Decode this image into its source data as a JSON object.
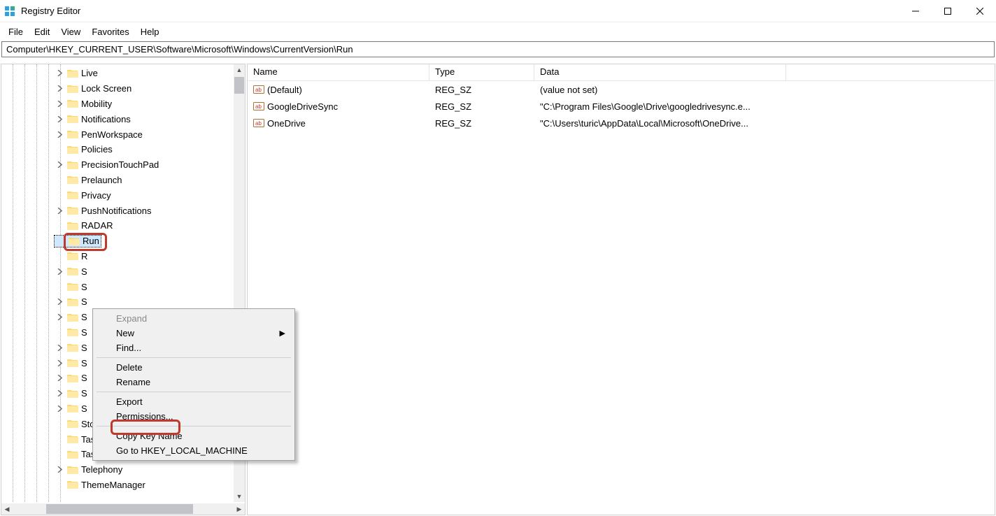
{
  "window": {
    "title": "Registry Editor"
  },
  "menu": {
    "file": "File",
    "edit": "Edit",
    "view": "View",
    "favorites": "Favorites",
    "help": "Help"
  },
  "address": "Computer\\HKEY_CURRENT_USER\\Software\\Microsoft\\Windows\\CurrentVersion\\Run",
  "tree": {
    "items": [
      {
        "label": "Live",
        "exp": true
      },
      {
        "label": "Lock Screen",
        "exp": true
      },
      {
        "label": "Mobility",
        "exp": true
      },
      {
        "label": "Notifications",
        "exp": true
      },
      {
        "label": "PenWorkspace",
        "exp": true
      },
      {
        "label": "Policies",
        "exp": false
      },
      {
        "label": "PrecisionTouchPad",
        "exp": true
      },
      {
        "label": "Prelaunch",
        "exp": false
      },
      {
        "label": "Privacy",
        "exp": false
      },
      {
        "label": "PushNotifications",
        "exp": true
      },
      {
        "label": "RADAR",
        "exp": false
      },
      {
        "label": "Run",
        "exp": false,
        "selected": true
      },
      {
        "label": "R",
        "exp": false
      },
      {
        "label": "S",
        "exp": true
      },
      {
        "label": "S",
        "exp": false
      },
      {
        "label": "S",
        "exp": true
      },
      {
        "label": "S",
        "exp": true
      },
      {
        "label": "S",
        "exp": false
      },
      {
        "label": "S",
        "exp": true
      },
      {
        "label": "S",
        "exp": true
      },
      {
        "label": "S",
        "exp": true
      },
      {
        "label": "S",
        "exp": true
      },
      {
        "label": "S",
        "exp": true
      },
      {
        "label": "Store",
        "exp": false
      },
      {
        "label": "TaskFlow",
        "exp": false
      },
      {
        "label": "TaskManager",
        "exp": false
      },
      {
        "label": "Telephony",
        "exp": true
      },
      {
        "label": "ThemeManager",
        "exp": false
      }
    ]
  },
  "list": {
    "cols": {
      "name": "Name",
      "type": "Type",
      "data": "Data"
    },
    "rows": [
      {
        "name": "(Default)",
        "type": "REG_SZ",
        "data": "(value not set)"
      },
      {
        "name": "GoogleDriveSync",
        "type": "REG_SZ",
        "data": "\"C:\\Program Files\\Google\\Drive\\googledrivesync.e..."
      },
      {
        "name": "OneDrive",
        "type": "REG_SZ",
        "data": "\"C:\\Users\\turic\\AppData\\Local\\Microsoft\\OneDrive..."
      }
    ]
  },
  "context_menu": {
    "expand": "Expand",
    "new": "New",
    "find": "Find...",
    "delete": "Delete",
    "rename": "Rename",
    "export": "Export",
    "permissions": "Permissions...",
    "copy_key": "Copy Key Name",
    "goto": "Go to HKEY_LOCAL_MACHINE"
  }
}
